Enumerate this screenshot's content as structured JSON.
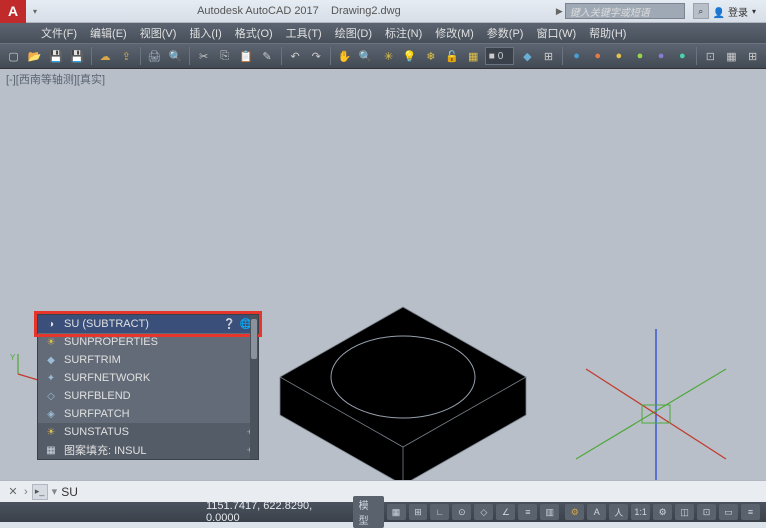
{
  "title": {
    "app": "Autodesk AutoCAD 2017",
    "file": "Drawing2.dwg"
  },
  "search": {
    "placeholder": "键入关键字或短语"
  },
  "login_label": "登录",
  "menu": {
    "items": [
      "文件(F)",
      "编辑(E)",
      "视图(V)",
      "插入(I)",
      "格式(O)",
      "工具(T)",
      "绘图(D)",
      "标注(N)",
      "修改(M)",
      "参数(P)",
      "窗口(W)",
      "帮助(H)"
    ]
  },
  "viewport_label": "[-][西南等轴测][真实]",
  "popup": {
    "selected": {
      "text": "SU  (SUBTRACT)"
    },
    "items": [
      {
        "icon": "sun",
        "text": "SUNPROPERTIES"
      },
      {
        "icon": "surf",
        "text": "SURFTRIM"
      },
      {
        "icon": "surf",
        "text": "SURFNETWORK"
      },
      {
        "icon": "surf",
        "text": "SURFBLEND"
      },
      {
        "icon": "surf",
        "text": "SURFPATCH"
      },
      {
        "icon": "sun",
        "text": "SUNSTATUS"
      },
      {
        "icon": "hatch",
        "text": "图案填充: INSUL"
      }
    ]
  },
  "command": {
    "value": "SU"
  },
  "status": {
    "coords": "1151.7417, 622.8290, 0.0000",
    "model_label": "模型"
  },
  "toolbar_options_text": "0",
  "icons": {
    "dropdown": "▾",
    "help": "?",
    "glyph": "⌘"
  }
}
